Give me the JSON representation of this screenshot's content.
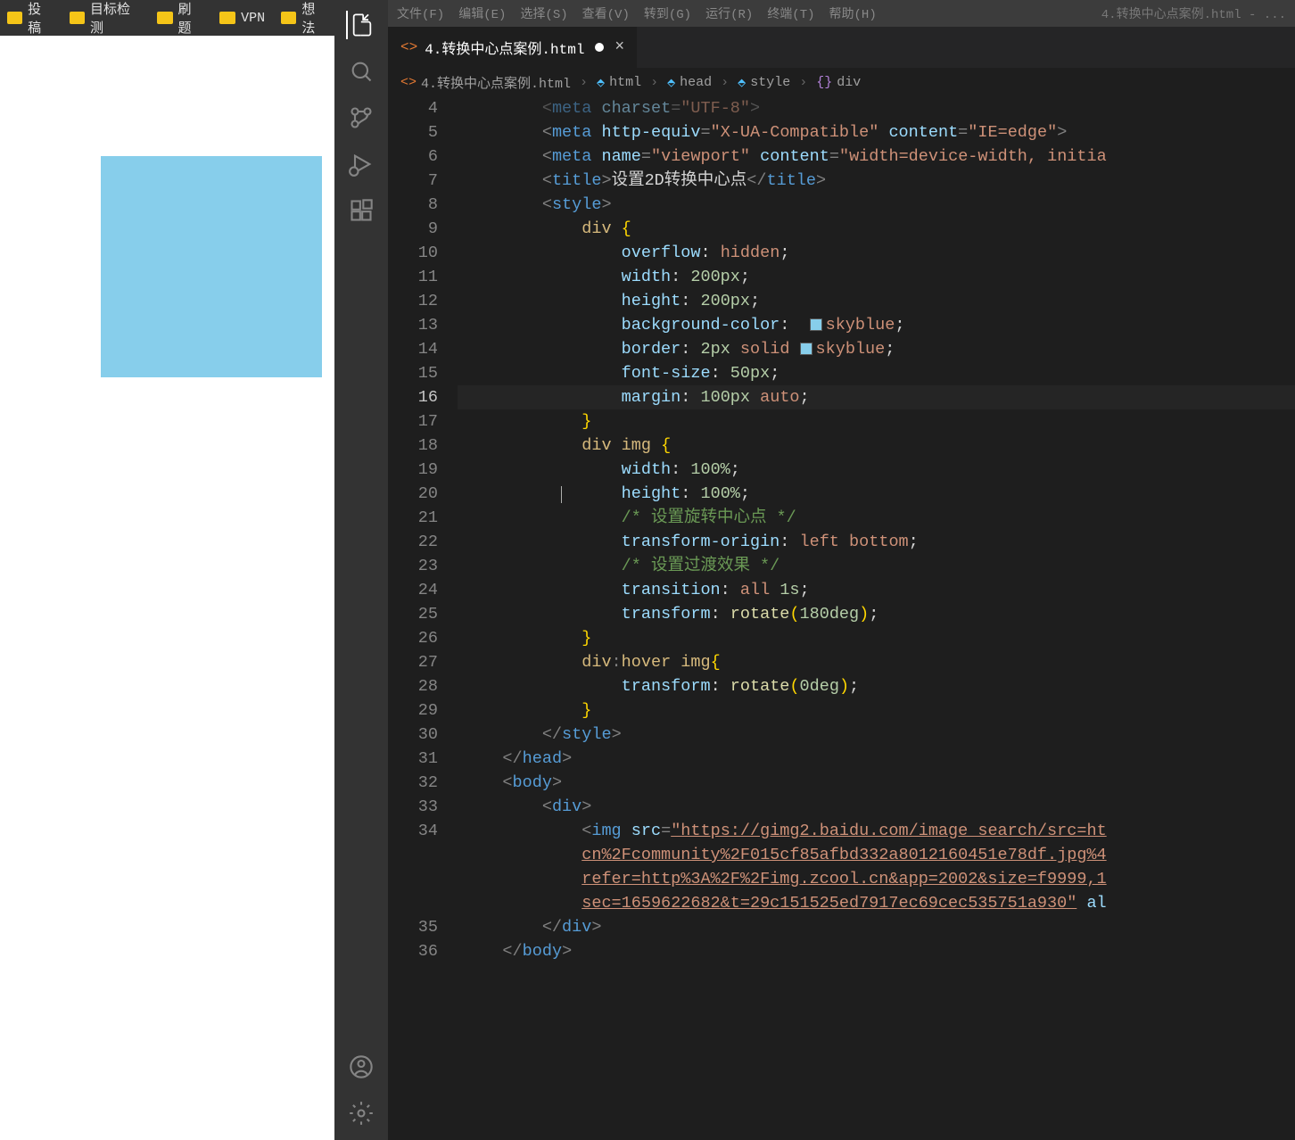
{
  "bookmarks": [
    "投稿",
    "目标检测",
    "刷题",
    "VPN",
    "想法"
  ],
  "menu": [
    "文件(F)",
    "编辑(E)",
    "选择(S)",
    "查看(V)",
    "转到(G)",
    "运行(R)",
    "终端(T)",
    "帮助(H)"
  ],
  "title_suffix": "4.转换中心点案例.html - ...",
  "tab": {
    "label": "4.转换中心点案例.html",
    "modified": true
  },
  "breadcrumbs": [
    "4.转换中心点案例.html",
    "html",
    "head",
    "style",
    "div"
  ],
  "line_numbers": [
    "4",
    "5",
    "6",
    "7",
    "8",
    "9",
    "10",
    "11",
    "12",
    "13",
    "14",
    "15",
    "16",
    "17",
    "18",
    "19",
    "20",
    "21",
    "22",
    "23",
    "24",
    "25",
    "26",
    "27",
    "28",
    "29",
    "30",
    "31",
    "32",
    "33",
    "34",
    "",
    "",
    "",
    "35",
    "36"
  ],
  "current_line_index": 12,
  "code_lines": [
    {
      "i": "        ",
      "t": [
        {
          "c": "punc",
          "v": "<"
        },
        {
          "c": "tag",
          "v": "meta"
        },
        {
          "c": "text",
          "v": " "
        },
        {
          "c": "attr",
          "v": "charset"
        },
        {
          "c": "punc",
          "v": "="
        },
        {
          "c": "str",
          "v": "\"UTF-8\""
        },
        {
          "c": "punc",
          "v": ">"
        }
      ],
      "dim": true
    },
    {
      "i": "        ",
      "t": [
        {
          "c": "punc",
          "v": "<"
        },
        {
          "c": "tag",
          "v": "meta"
        },
        {
          "c": "text",
          "v": " "
        },
        {
          "c": "attr",
          "v": "http-equiv"
        },
        {
          "c": "punc",
          "v": "="
        },
        {
          "c": "str",
          "v": "\"X-UA-Compatible\""
        },
        {
          "c": "text",
          "v": " "
        },
        {
          "c": "attr",
          "v": "content"
        },
        {
          "c": "punc",
          "v": "="
        },
        {
          "c": "str",
          "v": "\"IE=edge\""
        },
        {
          "c": "punc",
          "v": ">"
        }
      ]
    },
    {
      "i": "        ",
      "t": [
        {
          "c": "punc",
          "v": "<"
        },
        {
          "c": "tag",
          "v": "meta"
        },
        {
          "c": "text",
          "v": " "
        },
        {
          "c": "attr",
          "v": "name"
        },
        {
          "c": "punc",
          "v": "="
        },
        {
          "c": "str",
          "v": "\"viewport\""
        },
        {
          "c": "text",
          "v": " "
        },
        {
          "c": "attr",
          "v": "content"
        },
        {
          "c": "punc",
          "v": "="
        },
        {
          "c": "str",
          "v": "\"width=device-width, initia"
        }
      ]
    },
    {
      "i": "        ",
      "t": [
        {
          "c": "punc",
          "v": "<"
        },
        {
          "c": "tag",
          "v": "title"
        },
        {
          "c": "punc",
          "v": ">"
        },
        {
          "c": "text",
          "v": "设置2D转换中心点"
        },
        {
          "c": "punc",
          "v": "</"
        },
        {
          "c": "tag",
          "v": "title"
        },
        {
          "c": "punc",
          "v": ">"
        }
      ]
    },
    {
      "i": "        ",
      "t": [
        {
          "c": "punc",
          "v": "<"
        },
        {
          "c": "tag",
          "v": "style"
        },
        {
          "c": "punc",
          "v": ">"
        }
      ]
    },
    {
      "i": "            ",
      "t": [
        {
          "c": "sel",
          "v": "div"
        },
        {
          "c": "text",
          "v": " "
        },
        {
          "c": "brace",
          "v": "{"
        }
      ]
    },
    {
      "i": "                ",
      "t": [
        {
          "c": "prop",
          "v": "overflow"
        },
        {
          "c": "text",
          "v": ": "
        },
        {
          "c": "val",
          "v": "hidden"
        },
        {
          "c": "text",
          "v": ";"
        }
      ]
    },
    {
      "i": "                ",
      "t": [
        {
          "c": "prop",
          "v": "width"
        },
        {
          "c": "text",
          "v": ": "
        },
        {
          "c": "num",
          "v": "200px"
        },
        {
          "c": "text",
          "v": ";"
        }
      ]
    },
    {
      "i": "                ",
      "t": [
        {
          "c": "prop",
          "v": "height"
        },
        {
          "c": "text",
          "v": ": "
        },
        {
          "c": "num",
          "v": "200px"
        },
        {
          "c": "text",
          "v": ";"
        }
      ]
    },
    {
      "i": "                ",
      "t": [
        {
          "c": "prop",
          "v": "background-color"
        },
        {
          "c": "text",
          "v": ":  "
        },
        {
          "c": "swatch",
          "v": ""
        },
        {
          "c": "val",
          "v": "skyblue"
        },
        {
          "c": "text",
          "v": ";"
        }
      ]
    },
    {
      "i": "                ",
      "t": [
        {
          "c": "prop",
          "v": "border"
        },
        {
          "c": "text",
          "v": ": "
        },
        {
          "c": "num",
          "v": "2px"
        },
        {
          "c": "text",
          "v": " "
        },
        {
          "c": "val",
          "v": "solid"
        },
        {
          "c": "text",
          "v": " "
        },
        {
          "c": "swatch",
          "v": ""
        },
        {
          "c": "val",
          "v": "skyblue"
        },
        {
          "c": "text",
          "v": ";"
        }
      ]
    },
    {
      "i": "                ",
      "t": [
        {
          "c": "prop",
          "v": "font-size"
        },
        {
          "c": "text",
          "v": ": "
        },
        {
          "c": "num",
          "v": "50px"
        },
        {
          "c": "text",
          "v": ";"
        }
      ]
    },
    {
      "i": "                ",
      "t": [
        {
          "c": "prop",
          "v": "margin"
        },
        {
          "c": "text",
          "v": ": "
        },
        {
          "c": "num",
          "v": "100px"
        },
        {
          "c": "text",
          "v": " "
        },
        {
          "c": "val",
          "v": "auto"
        },
        {
          "c": "text",
          "v": ";"
        }
      ],
      "current": true
    },
    {
      "i": "            ",
      "t": [
        {
          "c": "brace",
          "v": "}"
        }
      ]
    },
    {
      "i": "            ",
      "t": [
        {
          "c": "sel",
          "v": "div"
        },
        {
          "c": "text",
          "v": " "
        },
        {
          "c": "sel",
          "v": "img"
        },
        {
          "c": "text",
          "v": " "
        },
        {
          "c": "brace",
          "v": "{"
        }
      ]
    },
    {
      "i": "                ",
      "t": [
        {
          "c": "prop",
          "v": "width"
        },
        {
          "c": "text",
          "v": ": "
        },
        {
          "c": "num",
          "v": "100%"
        },
        {
          "c": "text",
          "v": ";"
        }
      ]
    },
    {
      "i": "                ",
      "t": [
        {
          "c": "prop",
          "v": "height"
        },
        {
          "c": "text",
          "v": ": "
        },
        {
          "c": "num",
          "v": "100%"
        },
        {
          "c": "text",
          "v": ";"
        }
      ],
      "cursor": true
    },
    {
      "i": "                ",
      "t": [
        {
          "c": "cmt",
          "v": "/* 设置旋转中心点 */"
        }
      ]
    },
    {
      "i": "                ",
      "t": [
        {
          "c": "prop",
          "v": "transform-origin"
        },
        {
          "c": "text",
          "v": ": "
        },
        {
          "c": "val",
          "v": "left"
        },
        {
          "c": "text",
          "v": " "
        },
        {
          "c": "val",
          "v": "bottom"
        },
        {
          "c": "text",
          "v": ";"
        }
      ]
    },
    {
      "i": "                ",
      "t": [
        {
          "c": "cmt",
          "v": "/* 设置过渡效果 */"
        }
      ]
    },
    {
      "i": "                ",
      "t": [
        {
          "c": "prop",
          "v": "transition"
        },
        {
          "c": "text",
          "v": ": "
        },
        {
          "c": "val",
          "v": "all"
        },
        {
          "c": "text",
          "v": " "
        },
        {
          "c": "num",
          "v": "1s"
        },
        {
          "c": "text",
          "v": ";"
        }
      ]
    },
    {
      "i": "                ",
      "t": [
        {
          "c": "prop",
          "v": "transform"
        },
        {
          "c": "text",
          "v": ": "
        },
        {
          "c": "func",
          "v": "rotate"
        },
        {
          "c": "brace",
          "v": "("
        },
        {
          "c": "num",
          "v": "180deg"
        },
        {
          "c": "brace",
          "v": ")"
        },
        {
          "c": "text",
          "v": ";"
        }
      ]
    },
    {
      "i": "            ",
      "t": [
        {
          "c": "brace",
          "v": "}"
        }
      ]
    },
    {
      "i": "            ",
      "t": [
        {
          "c": "sel",
          "v": "div"
        },
        {
          "c": "punc",
          "v": ":"
        },
        {
          "c": "sel",
          "v": "hover"
        },
        {
          "c": "text",
          "v": " "
        },
        {
          "c": "sel",
          "v": "img"
        },
        {
          "c": "brace",
          "v": "{"
        }
      ]
    },
    {
      "i": "                ",
      "t": [
        {
          "c": "prop",
          "v": "transform"
        },
        {
          "c": "text",
          "v": ": "
        },
        {
          "c": "func",
          "v": "rotate"
        },
        {
          "c": "brace",
          "v": "("
        },
        {
          "c": "num",
          "v": "0deg"
        },
        {
          "c": "brace",
          "v": ")"
        },
        {
          "c": "text",
          "v": ";"
        }
      ]
    },
    {
      "i": "            ",
      "t": [
        {
          "c": "brace",
          "v": "}"
        }
      ]
    },
    {
      "i": "        ",
      "t": [
        {
          "c": "punc",
          "v": "</"
        },
        {
          "c": "tag",
          "v": "style"
        },
        {
          "c": "punc",
          "v": ">"
        }
      ]
    },
    {
      "i": "    ",
      "t": [
        {
          "c": "punc",
          "v": "</"
        },
        {
          "c": "tag",
          "v": "head"
        },
        {
          "c": "punc",
          "v": ">"
        }
      ]
    },
    {
      "i": "    ",
      "t": [
        {
          "c": "punc",
          "v": "<"
        },
        {
          "c": "tag",
          "v": "body"
        },
        {
          "c": "punc",
          "v": ">"
        }
      ]
    },
    {
      "i": "        ",
      "t": [
        {
          "c": "punc",
          "v": "<"
        },
        {
          "c": "tag",
          "v": "div"
        },
        {
          "c": "punc",
          "v": ">"
        }
      ]
    },
    {
      "i": "            ",
      "t": [
        {
          "c": "punc",
          "v": "<"
        },
        {
          "c": "tag",
          "v": "img"
        },
        {
          "c": "text",
          "v": " "
        },
        {
          "c": "attr",
          "v": "src"
        },
        {
          "c": "punc",
          "v": "="
        },
        {
          "c": "url",
          "v": "\"https://gimg2.baidu.com/image_search/src=ht"
        }
      ]
    },
    {
      "i": "            ",
      "t": [
        {
          "c": "url",
          "v": "cn%2Fcommunity%2F015cf85afbd332a8012160451e78df.jpg%4"
        }
      ]
    },
    {
      "i": "            ",
      "t": [
        {
          "c": "url",
          "v": "refer=http%3A%2F%2Fimg.zcool.cn&app=2002&size=f9999,1"
        }
      ]
    },
    {
      "i": "            ",
      "t": [
        {
          "c": "url",
          "v": "sec=1659622682&t=29c151525ed7917ec69cec535751a930\""
        },
        {
          "c": "text",
          "v": " "
        },
        {
          "c": "attr",
          "v": "al"
        }
      ]
    },
    {
      "i": "        ",
      "t": [
        {
          "c": "punc",
          "v": "</"
        },
        {
          "c": "tag",
          "v": "div"
        },
        {
          "c": "punc",
          "v": ">"
        }
      ]
    },
    {
      "i": "    ",
      "t": [
        {
          "c": "punc",
          "v": "</"
        },
        {
          "c": "tag",
          "v": "body"
        },
        {
          "c": "punc",
          "v": ">"
        }
      ]
    }
  ]
}
